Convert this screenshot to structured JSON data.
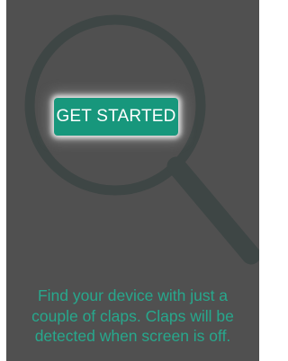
{
  "main": {
    "button_label": "GET STARTED",
    "hint_lines": [
      "Find your device with just a",
      "couple of claps. Claps will be",
      "detected when screen is off."
    ],
    "magnifier_icon": "magnifier-icon"
  },
  "colors": {
    "background": "#505050",
    "accent": "#17977c",
    "hint_text": "#27a88d",
    "magnifier": "#3e4645"
  }
}
